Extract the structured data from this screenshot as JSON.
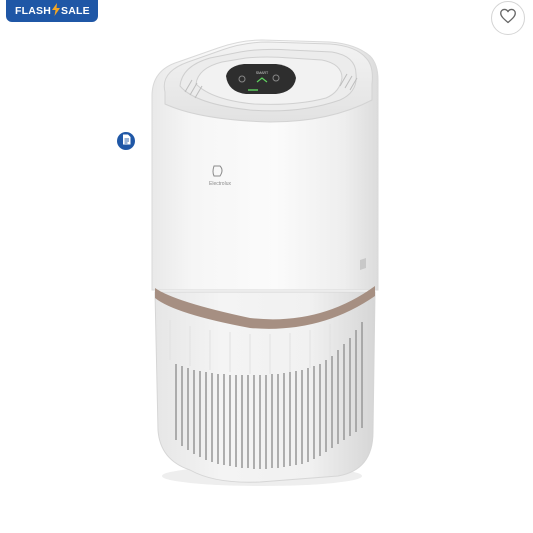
{
  "badge": {
    "left_text": "FLASH",
    "right_text": "SALE",
    "bolt_icon": "lightning-bolt-icon",
    "color": "#1f57a6",
    "bolt_color": "#f5a623"
  },
  "wishlist": {
    "icon": "heart-outline-icon"
  },
  "spec_button": {
    "icon": "document-icon",
    "color": "#1f57a6"
  },
  "product": {
    "brand_label": "Electrolux",
    "panel_label": "SMART",
    "accent_color": "#a68f82"
  }
}
